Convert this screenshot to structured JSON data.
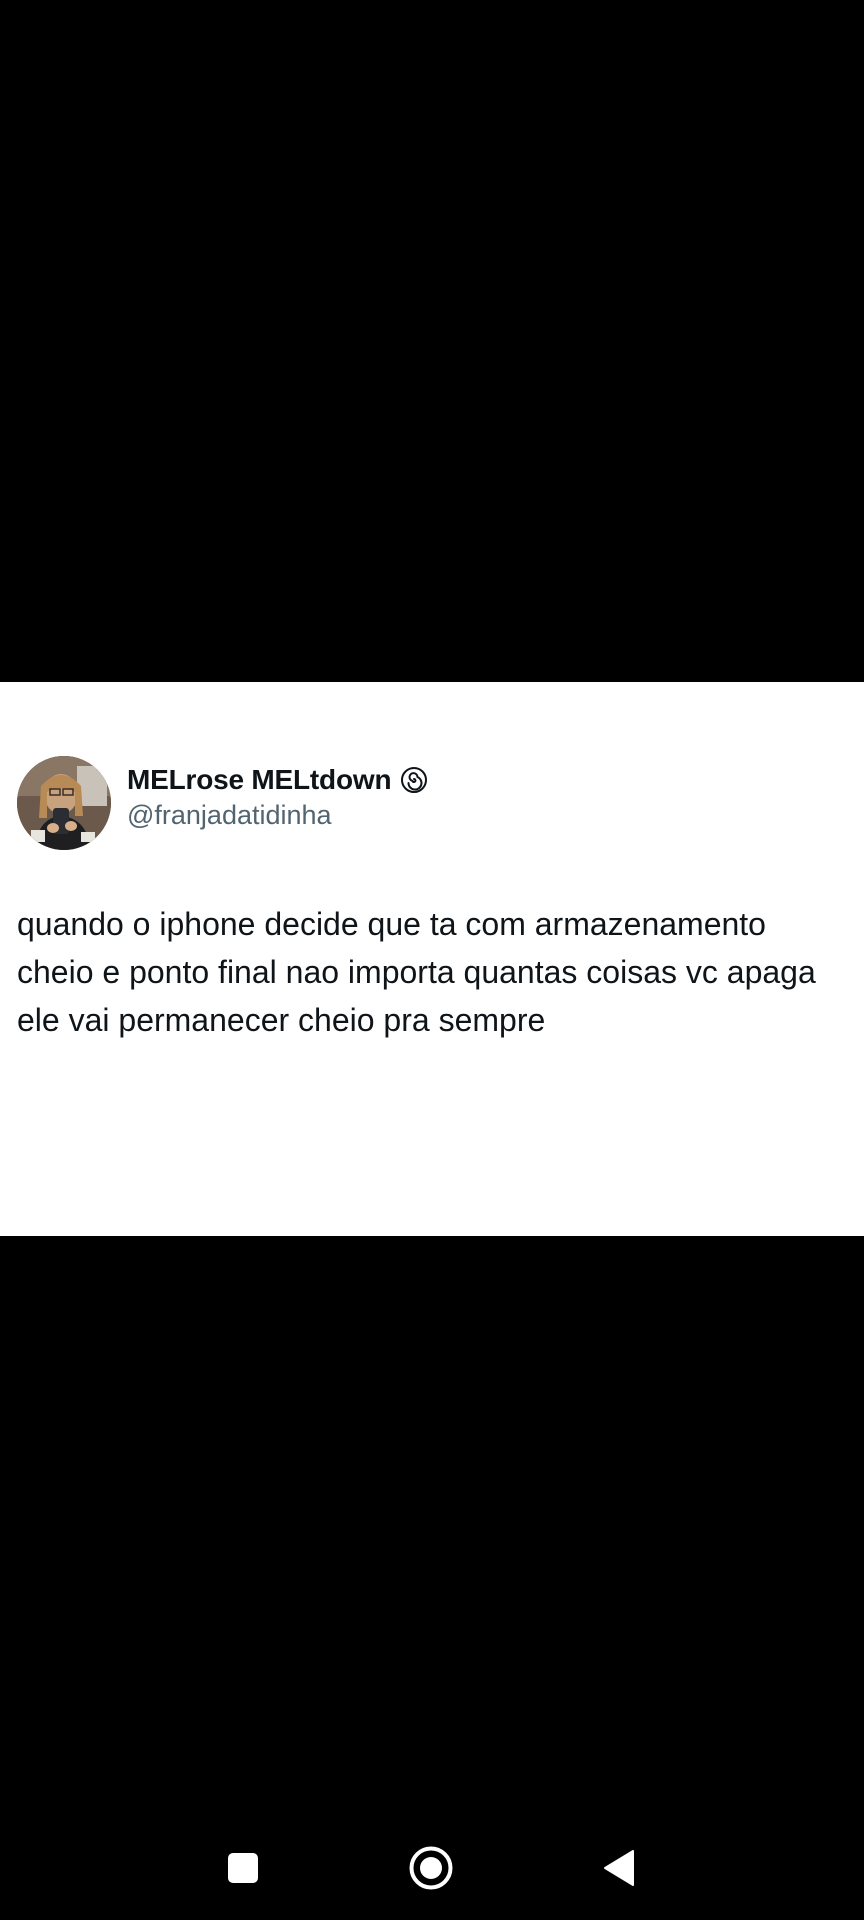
{
  "tweet": {
    "display_name": "MELrose MELtdown",
    "badge_icon": "spiral-icon",
    "handle": "@franjadatidinha",
    "text": "quando o iphone decide que ta com armazenamento cheio e ponto final nao importa quantas coisas vc apaga ele vai permanecer cheio pra sempre"
  },
  "navigation_bar": {
    "items": [
      {
        "icon": "recent-apps-icon"
      },
      {
        "icon": "home-icon"
      },
      {
        "icon": "back-icon"
      }
    ]
  },
  "colors": {
    "background": "#000000",
    "card": "#ffffff",
    "text_primary": "#0f1419",
    "text_secondary": "#536471",
    "nav_icons": "#ffffff"
  }
}
